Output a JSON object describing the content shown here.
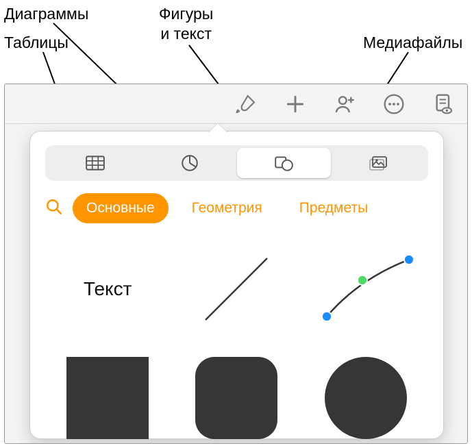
{
  "callouts": {
    "diagrams": "Диаграммы",
    "tables": "Таблицы",
    "shapes_text": "Фигуры\nи текст",
    "media": "Медиафайлы"
  },
  "toolbar": {
    "format_btn": "format",
    "insert_btn": "insert",
    "collab_btn": "collaborate",
    "more_btn": "more",
    "view_btn": "view-document"
  },
  "segments": {
    "tables": "tables",
    "charts": "charts",
    "shapes": "shapes",
    "media": "media"
  },
  "categories": {
    "basic": "Основные",
    "geometry": "Геометрия",
    "objects": "Предметы"
  },
  "items": {
    "text_label": "Текст"
  }
}
